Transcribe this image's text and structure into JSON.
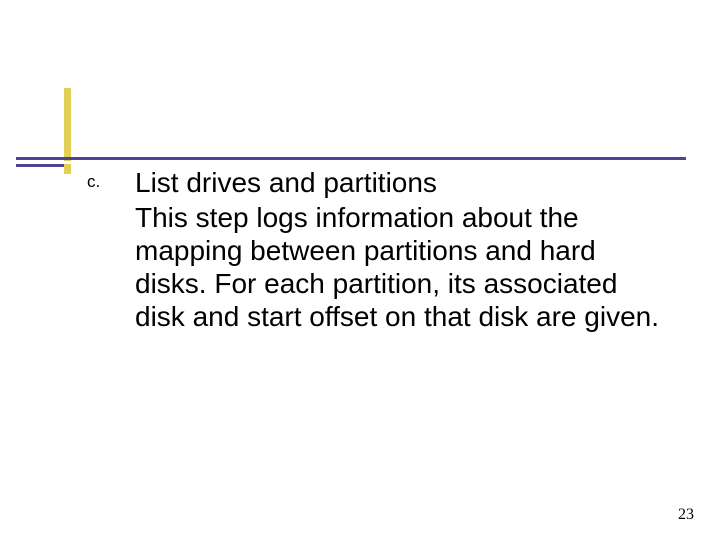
{
  "list": {
    "marker": "c.",
    "heading": "List drives and partitions",
    "body": "This step logs information about the mapping between partitions and hard disks. For each partition, its associated disk and start offset on that disk are given."
  },
  "page_number": "23"
}
